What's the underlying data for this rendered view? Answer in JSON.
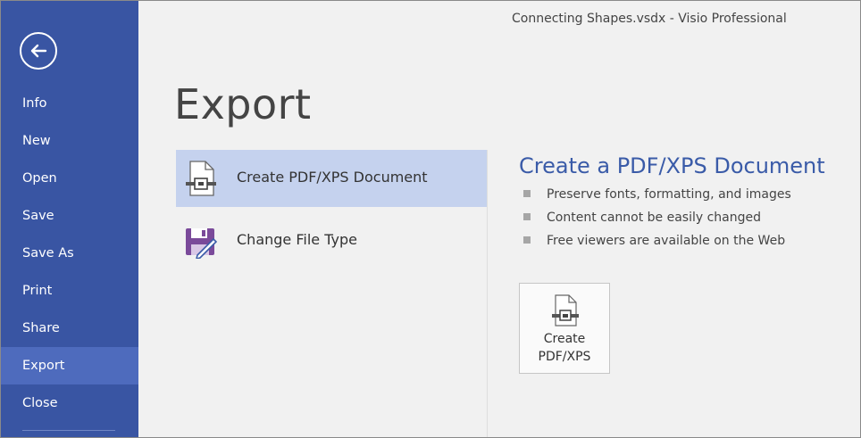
{
  "window": {
    "title": "Connecting Shapes.vsdx - Visio Professional"
  },
  "sidebar": {
    "items": [
      {
        "label": "Info"
      },
      {
        "label": "New"
      },
      {
        "label": "Open"
      },
      {
        "label": "Save"
      },
      {
        "label": "Save As"
      },
      {
        "label": "Print"
      },
      {
        "label": "Share"
      },
      {
        "label": "Export",
        "active": true
      },
      {
        "label": "Close"
      }
    ]
  },
  "main": {
    "title": "Export",
    "options": [
      {
        "label": "Create PDF/XPS Document",
        "icon": "pdf-document-icon",
        "selected": true
      },
      {
        "label": "Change File Type",
        "icon": "change-file-type-icon"
      }
    ]
  },
  "detail": {
    "title": "Create a PDF/XPS Document",
    "bullets": [
      "Preserve fonts, formatting, and images",
      "Content cannot be easily changed",
      "Free viewers are available on the Web"
    ],
    "button": {
      "line1": "Create",
      "line2": "PDF/XPS",
      "icon": "pdf-document-icon"
    }
  },
  "colors": {
    "sidebar_bg": "#3955a3",
    "sidebar_active": "#4e6bbd",
    "accent_title": "#3a5ba8",
    "selected_bg": "#c5d2ee",
    "file_type_icon": "#7a4a9a"
  }
}
